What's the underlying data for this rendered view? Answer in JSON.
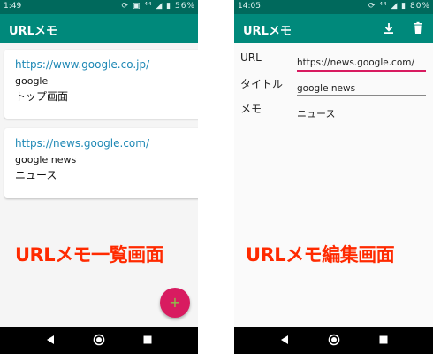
{
  "list_screen": {
    "status_time": "1:49",
    "status_icons": "⟳ ▣ ⁴⁴ ◢ ▮ 56%",
    "app_title": "URLメモ",
    "items": [
      {
        "url": "https://www.google.co.jp/",
        "title": "google",
        "memo": "トップ画面"
      },
      {
        "url": "https://news.google.com/",
        "title": "google news",
        "memo": "ニュース"
      }
    ],
    "fab_label": "+",
    "caption": "URLメモ一覧画面"
  },
  "edit_screen": {
    "status_time": "14:05",
    "status_icons": "⟳ ⁴⁴ ◢ ▮ 80%",
    "app_title": "URLメモ",
    "fields": {
      "url_label": "URL",
      "url_value": "https://news.google.com/",
      "title_label": "タイトル",
      "title_value": "google news",
      "memo_label": "メモ",
      "memo_value": "ニュース"
    },
    "caption": "URLメモ編集画面"
  },
  "colors": {
    "status_bar": "#00695c",
    "app_bar": "#00897b",
    "fab": "#d81b60",
    "caption": "#ff2a00",
    "link": "#1e88b5"
  }
}
